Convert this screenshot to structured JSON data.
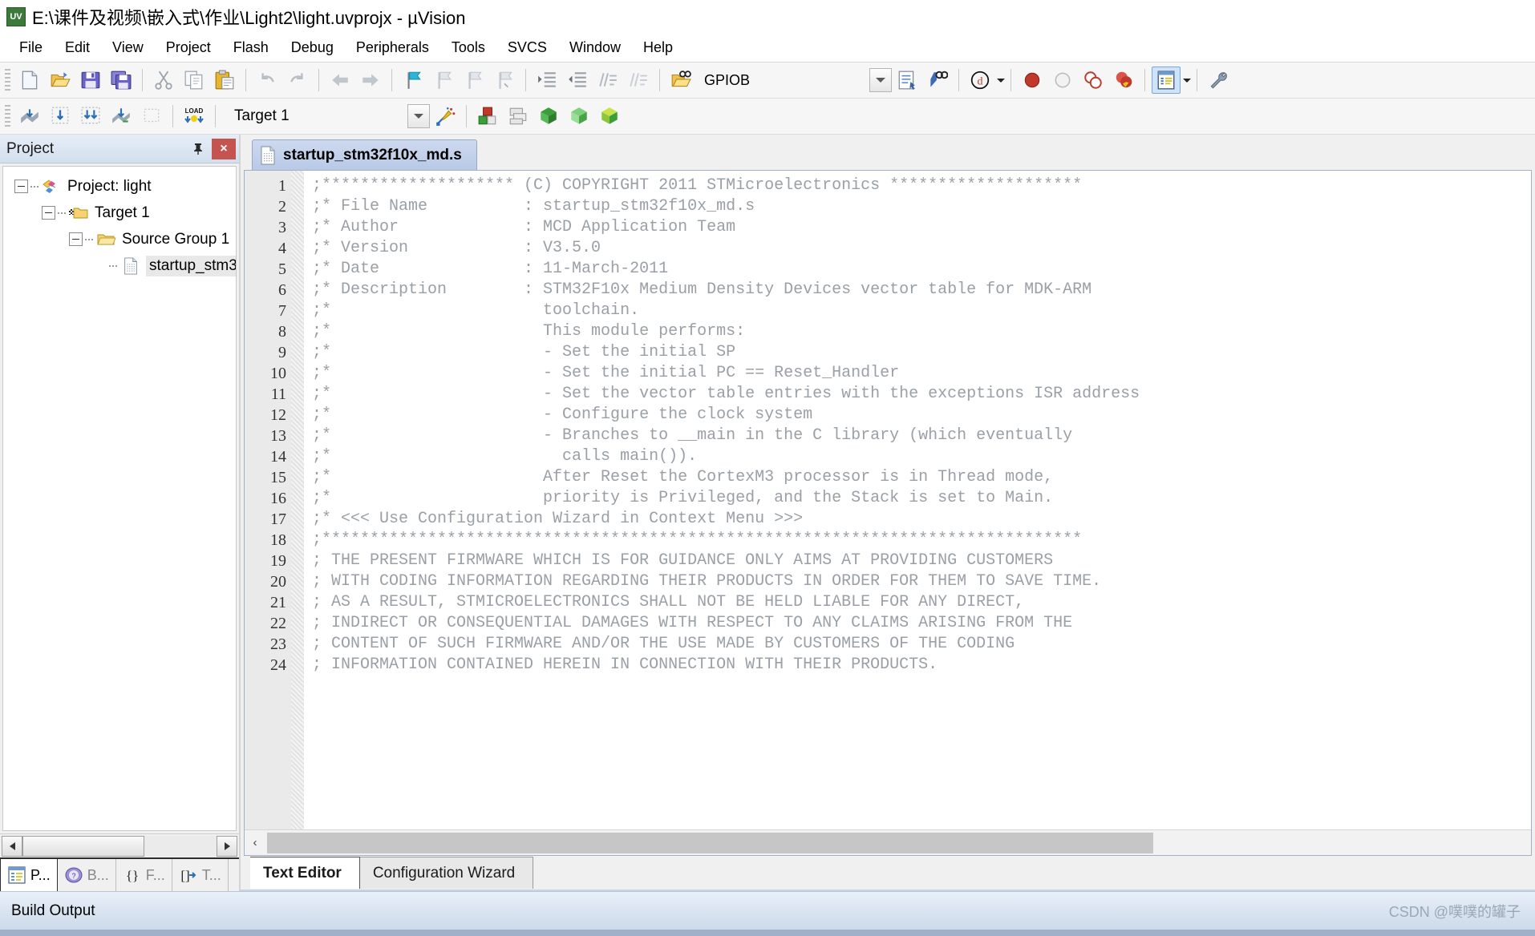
{
  "window": {
    "title": "E:\\课件及视频\\嵌入式\\作业\\Light2\\light.uvprojx - µVision",
    "app_icon": "uvision-logo-icon"
  },
  "menubar": {
    "items": [
      {
        "label": "File"
      },
      {
        "label": "Edit"
      },
      {
        "label": "View"
      },
      {
        "label": "Project"
      },
      {
        "label": "Flash"
      },
      {
        "label": "Debug"
      },
      {
        "label": "Peripherals"
      },
      {
        "label": "Tools"
      },
      {
        "label": "SVCS"
      },
      {
        "label": "Window"
      },
      {
        "label": "Help"
      }
    ]
  },
  "toolbar_main": {
    "search_value": "GPIOB",
    "search_placeholder": "",
    "buttons": [
      {
        "name": "new-file-icon",
        "title": "New"
      },
      {
        "name": "open-file-icon",
        "title": "Open"
      },
      {
        "name": "save-icon",
        "title": "Save"
      },
      {
        "name": "save-all-icon",
        "title": "Save All"
      },
      {
        "name": "cut-icon",
        "title": "Cut"
      },
      {
        "name": "copy-icon",
        "title": "Copy"
      },
      {
        "name": "paste-icon",
        "title": "Paste"
      },
      {
        "name": "undo-icon",
        "title": "Undo"
      },
      {
        "name": "redo-icon",
        "title": "Redo"
      },
      {
        "name": "navigate-back-icon",
        "title": "Back"
      },
      {
        "name": "navigate-forward-icon",
        "title": "Forward"
      },
      {
        "name": "bookmark-toggle-icon",
        "title": "Insert/Remove Bookmark"
      },
      {
        "name": "bookmark-prev-icon",
        "title": "Previous Bookmark"
      },
      {
        "name": "bookmark-next-icon",
        "title": "Next Bookmark"
      },
      {
        "name": "bookmark-clear-icon",
        "title": "Clear All Bookmarks"
      },
      {
        "name": "indent-right-icon",
        "title": "Indent"
      },
      {
        "name": "indent-left-icon",
        "title": "Outdent"
      },
      {
        "name": "comment-icon",
        "title": "Comment"
      },
      {
        "name": "uncomment-icon",
        "title": "Uncomment"
      },
      {
        "name": "find-in-files-icon",
        "title": "Find in Files"
      }
    ],
    "right_buttons": [
      {
        "name": "bookmark-list-icon",
        "title": "Bookmarks"
      },
      {
        "name": "find-document-icon",
        "title": "Find"
      },
      {
        "name": "find-binoculars-icon",
        "title": "Find in Files"
      },
      {
        "name": "debug-session-icon",
        "title": "Start/Stop Debug Session"
      },
      {
        "name": "breakpoint-insert-icon",
        "title": "Insert/Remove Breakpoint"
      },
      {
        "name": "breakpoint-disable-icon",
        "title": "Enable/Disable Breakpoint"
      },
      {
        "name": "breakpoint-disable-all-icon",
        "title": "Disable All Breakpoints"
      },
      {
        "name": "breakpoint-kill-all-icon",
        "title": "Kill All Breakpoints"
      },
      {
        "name": "project-window-icon",
        "title": "Project Window"
      },
      {
        "name": "configure-wrench-icon",
        "title": "Configure"
      }
    ]
  },
  "toolbar_build": {
    "target_value": "Target 1",
    "buttons": [
      {
        "name": "translate-icon",
        "title": "Translate"
      },
      {
        "name": "build-icon",
        "title": "Build"
      },
      {
        "name": "rebuild-icon",
        "title": "Rebuild"
      },
      {
        "name": "batch-build-icon",
        "title": "Batch Build"
      },
      {
        "name": "stop-build-icon",
        "title": "Stop Build"
      },
      {
        "name": "download-load-icon",
        "title": "Download (LOAD)"
      },
      {
        "name": "target-options-icon",
        "title": "Options for Target"
      },
      {
        "name": "manage-project-items-icon",
        "title": "Manage Project Items"
      },
      {
        "name": "pack-installer-icon",
        "title": "Pack Installer"
      },
      {
        "name": "manage-run-time-icon",
        "title": "Manage Run-Time Environment"
      },
      {
        "name": "select-software-packs-icon",
        "title": "Select Software Packs"
      }
    ]
  },
  "project_panel": {
    "title": "Project",
    "pin_icon": "pin-icon",
    "close_icon": "close-icon",
    "tree": [
      {
        "label": "Project: light",
        "level": 0,
        "icon": "project-icon",
        "expanded": true,
        "selected": false
      },
      {
        "label": "Target 1",
        "level": 1,
        "icon": "target-folder-icon",
        "expanded": true,
        "selected": false
      },
      {
        "label": "Source Group 1",
        "level": 2,
        "icon": "folder-icon",
        "expanded": true,
        "selected": false
      },
      {
        "label": "startup_stm3?",
        "level": 3,
        "icon": "asm-file-icon",
        "expanded": false,
        "selected": true
      }
    ],
    "tabs": [
      {
        "label": "P...",
        "icon": "project-window-icon",
        "active": true
      },
      {
        "label": "B...",
        "icon": "books-icon",
        "active": false
      },
      {
        "label": "F...",
        "icon": "functions-braces-icon",
        "active": false
      },
      {
        "label": "T...",
        "icon": "templates-icon",
        "active": false
      }
    ]
  },
  "editor": {
    "doc_tab": {
      "label": "startup_stm32f10x_md.s",
      "icon": "asm-file-icon"
    },
    "lines": [
      {
        "n": 1,
        "text": ";******************** (C) COPYRIGHT 2011 STMicroelectronics ********************"
      },
      {
        "n": 2,
        "text": ";* File Name          : startup_stm32f10x_md.s"
      },
      {
        "n": 3,
        "text": ";* Author             : MCD Application Team"
      },
      {
        "n": 4,
        "text": ";* Version            : V3.5.0"
      },
      {
        "n": 5,
        "text": ";* Date               : 11-March-2011"
      },
      {
        "n": 6,
        "text": ";* Description        : STM32F10x Medium Density Devices vector table for MDK-ARM"
      },
      {
        "n": 7,
        "text": ";*                      toolchain."
      },
      {
        "n": 8,
        "text": ";*                      This module performs:"
      },
      {
        "n": 9,
        "text": ";*                      - Set the initial SP"
      },
      {
        "n": 10,
        "text": ";*                      - Set the initial PC == Reset_Handler"
      },
      {
        "n": 11,
        "text": ";*                      - Set the vector table entries with the exceptions ISR address"
      },
      {
        "n": 12,
        "text": ";*                      - Configure the clock system"
      },
      {
        "n": 13,
        "text": ";*                      - Branches to __main in the C library (which eventually"
      },
      {
        "n": 14,
        "text": ";*                        calls main())."
      },
      {
        "n": 15,
        "text": ";*                      After Reset the CortexM3 processor is in Thread mode,"
      },
      {
        "n": 16,
        "text": ";*                      priority is Privileged, and the Stack is set to Main."
      },
      {
        "n": 17,
        "text": ";* <<< Use Configuration Wizard in Context Menu >>>"
      },
      {
        "n": 18,
        "text": ";*******************************************************************************"
      },
      {
        "n": 19,
        "text": "; THE PRESENT FIRMWARE WHICH IS FOR GUIDANCE ONLY AIMS AT PROVIDING CUSTOMERS"
      },
      {
        "n": 20,
        "text": "; WITH CODING INFORMATION REGARDING THEIR PRODUCTS IN ORDER FOR THEM TO SAVE TIME."
      },
      {
        "n": 21,
        "text": "; AS A RESULT, STMICROELECTRONICS SHALL NOT BE HELD LIABLE FOR ANY DIRECT,"
      },
      {
        "n": 22,
        "text": "; INDIRECT OR CONSEQUENTIAL DAMAGES WITH RESPECT TO ANY CLAIMS ARISING FROM THE"
      },
      {
        "n": 23,
        "text": "; CONTENT OF SUCH FIRMWARE AND/OR THE USE MADE BY CUSTOMERS OF THE CODING"
      },
      {
        "n": 24,
        "text": "; INFORMATION CONTAINED HEREIN IN CONNECTION WITH THEIR PRODUCTS."
      }
    ],
    "bottom_tabs": [
      {
        "label": "Text Editor",
        "active": true
      },
      {
        "label": "Configuration Wizard",
        "active": false
      }
    ]
  },
  "build_output": {
    "title": "Build Output",
    "watermark": "CSDN @噗噗的罐子"
  },
  "colors": {
    "comment": "#9aa0a6",
    "titlebar_bg": "#ffffff",
    "panel_header": "#d3dfee",
    "accent": "#1f4e9c",
    "close_red": "#c4544f",
    "tab_active": "#b9c9e6"
  }
}
